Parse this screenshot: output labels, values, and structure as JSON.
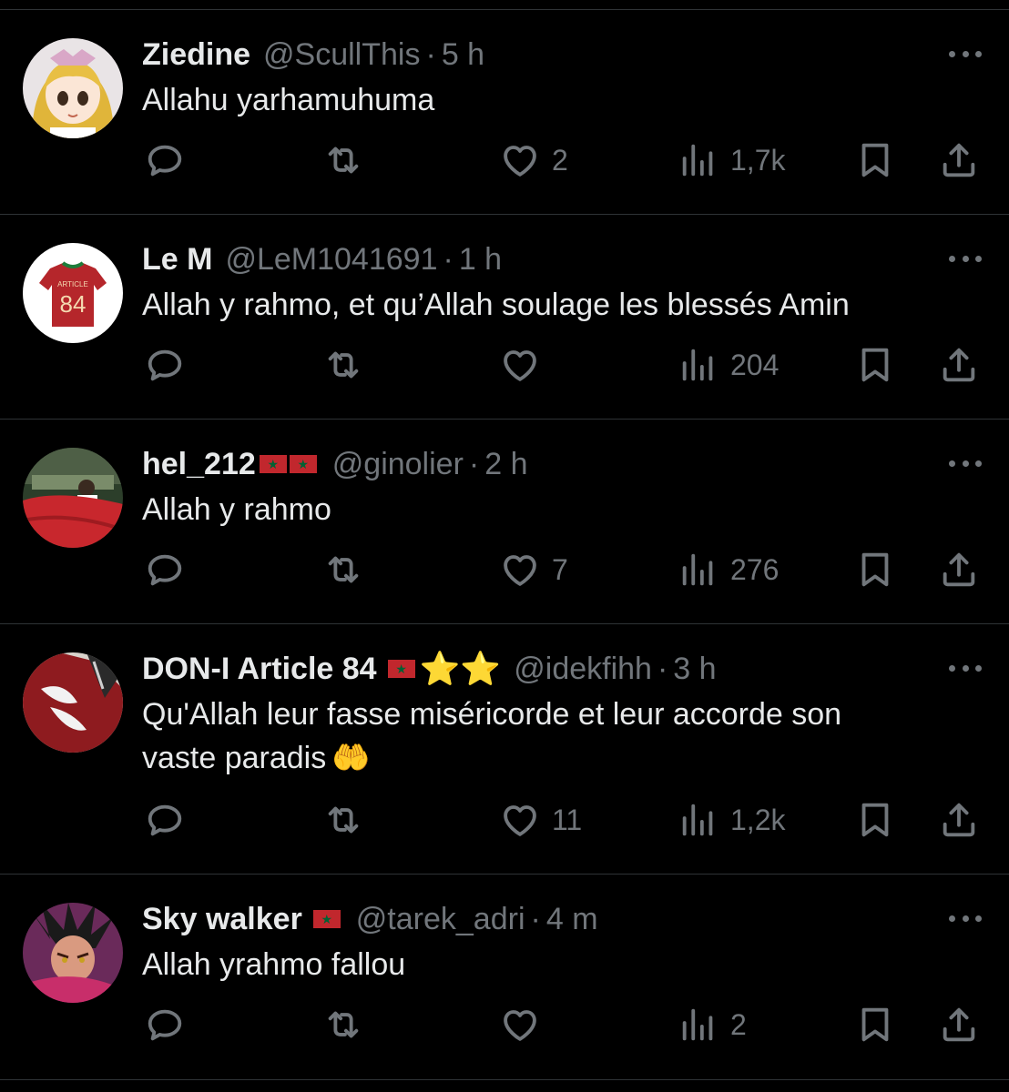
{
  "tweets": [
    {
      "name": "Ziedine",
      "handle": "@ScullThis",
      "separator": "·",
      "time": "5 h",
      "text": "Allahu yarhamuhuma",
      "likes": "2",
      "views": "1,7k",
      "avatar_icon": "anime-girl-avatar"
    },
    {
      "name": "Le M",
      "handle": "@LeM1041691",
      "separator": "·",
      "time": "1 h",
      "text": "Allah y rahmo, et qu’Allah soulage les blessés Amin",
      "likes": "",
      "views": "204",
      "avatar_icon": "jersey-avatar",
      "avatar_text_top": "ARTICLE",
      "avatar_text_number": "84"
    },
    {
      "name": "hel_212",
      "handle": "@ginolier",
      "separator": "·",
      "time": "2 h",
      "text": "Allah y rahmo",
      "likes": "7",
      "views": "276",
      "avatar_icon": "stadium-flag-avatar",
      "flag_icon": "morocco-flag-icon"
    },
    {
      "name": "DON-I Article 84",
      "handle": "@idekfihh",
      "separator": "·",
      "time": "3 h",
      "text_line1": "Qu'Allah leur fasse miséricorde et leur accorde son",
      "text_line2": "vaste paradis",
      "emoji": "🤲",
      "stars": "⭐⭐",
      "likes": "11",
      "views": "1,2k",
      "avatar_icon": "red-jersey-avatar",
      "flag_icon": "morocco-flag-icon"
    },
    {
      "name": "Sky walker",
      "handle": "@tarek_adri",
      "separator": "·",
      "time": "4 m",
      "text": "Allah yrahmo fallou",
      "likes": "",
      "views": "2",
      "avatar_icon": "anime-warrior-avatar",
      "flag_icon": "morocco-flag-icon"
    }
  ],
  "colors": {
    "background": "#000000",
    "text_primary": "#e7e9ea",
    "text_secondary": "#71767b",
    "divider": "#2f3336",
    "flag_red": "#c1272d",
    "flag_green": "#006233"
  }
}
